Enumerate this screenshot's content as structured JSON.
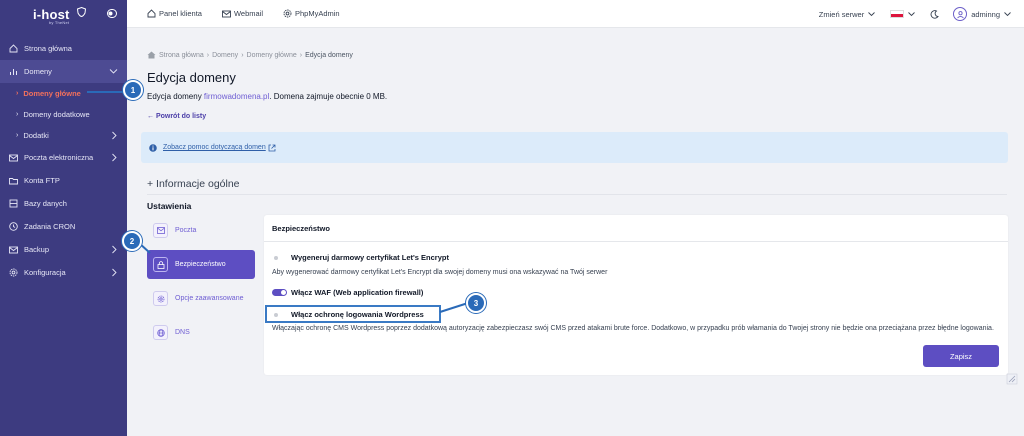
{
  "logo": {
    "name": "i-host",
    "sub": "by TheNet"
  },
  "sidebar": {
    "items": [
      {
        "label": "Strona główna"
      },
      {
        "label": "Domeny"
      },
      {
        "label": "Domeny główne"
      },
      {
        "label": "Domeny dodatkowe"
      },
      {
        "label": "Dodatki"
      },
      {
        "label": "Poczta elektroniczna"
      },
      {
        "label": "Konta FTP"
      },
      {
        "label": "Bazy danych"
      },
      {
        "label": "Zadania CRON"
      },
      {
        "label": "Backup"
      },
      {
        "label": "Konfiguracja"
      }
    ]
  },
  "topbar": {
    "links": [
      "Panel klienta",
      "Webmail",
      "PhpMyAdmin"
    ],
    "server": "Zmień serwer",
    "user": "adminng"
  },
  "badges": [
    "1",
    "2",
    "3"
  ],
  "breadcrumb": [
    "Strona główna",
    "Domeny",
    "Domeny główne",
    "Edycja domeny"
  ],
  "page": {
    "title": "Edycja domeny",
    "desc_prefix": "Edycja domeny ",
    "domain": "firmowadomena.pl",
    "desc_suffix": ". Domena zajmuje obecnie 0 MB.",
    "back": "← Powrót do listy",
    "help_link": "Zobacz pomoc dotyczącą domen",
    "section": "+ Informacje ogólne",
    "settings": "Ustawienia"
  },
  "tabs": [
    "Poczta",
    "Bezpieczeństwo",
    "Opcje zaawansowane",
    "DNS"
  ],
  "card": {
    "title": "Bezpieczeństwo",
    "opt1": "Wygeneruj darmowy certyfikat Let's Encrypt",
    "opt1_desc": "Aby wygenerować darmowy certyfikat Let's Encrypt dla swojej domeny musi ona wskazywać na Twój serwer",
    "opt2": "Włącz WAF (Web application firewall)",
    "opt3": "Włącz ochronę logowania Wordpress",
    "opt3_desc": "Włączając ochronę CMS Wordpress poprzez dodatkową autoryzację zabezpieczasz swój CMS przed atakami brute force. Dodatkowo, w przypadku prób włamania do Twojej strony nie będzie ona przeciążana przez błędne logowania.",
    "save": "Zapisz"
  },
  "colors": {
    "sidebar": "#3d3b80",
    "accent": "#5d4ec2",
    "active_sub": "#f2705c",
    "badge": "#2a6ab8"
  }
}
